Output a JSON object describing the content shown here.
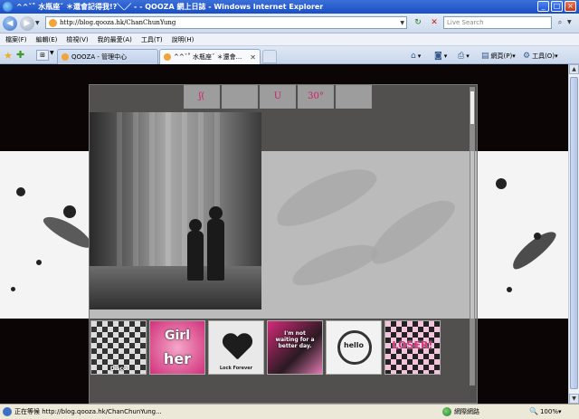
{
  "window": {
    "title": "^^ˇ˚ 水瓶座ˇ ＊還會記得我!?＼／ - - QOOZA 網上日誌 - Windows Internet Explorer"
  },
  "address_bar": {
    "url": "http://blog.qooza.hk/ChanChunYung",
    "search_placeholder": "Live Search"
  },
  "menu": {
    "items": [
      "檔案(F)",
      "編輯(E)",
      "檢視(V)",
      "我的最愛(A)",
      "工具(T)",
      "說明(H)"
    ]
  },
  "tabs": [
    {
      "label": "QOOZA - 管理中心"
    },
    {
      "label": "^^ˇ˚ 水瓶座ˇ ＊還會..."
    }
  ],
  "command_bar": {
    "page_label": "網頁(P)",
    "tools_label": "工具(O)"
  },
  "blog": {
    "nav_buttons": [
      "ʃ(",
      "",
      "U",
      "30°",
      ""
    ],
    "stickers": [
      {
        "text": "Disco"
      },
      {
        "text_top": "Girl",
        "text_bottom": "her"
      },
      {
        "text": "Lock Forever"
      },
      {
        "text": "I'm not waiting for a better day."
      },
      {
        "text": "hello"
      },
      {
        "text": "LOSER!"
      }
    ]
  },
  "status_bar": {
    "text": "正在等候 http://blog.qooza.hk/ChanChunYung...",
    "zone": "網際網路",
    "zoom": "100%"
  },
  "colors": {
    "titlebar": "#1a4fc4",
    "accent_pink": "#d2307b",
    "page_background": "#0c0505"
  }
}
